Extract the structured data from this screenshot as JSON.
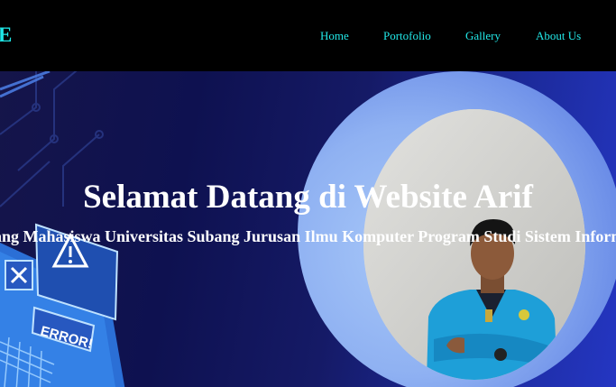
{
  "brand": {
    "logo_text": "E"
  },
  "nav": {
    "items": [
      {
        "label": "Home"
      },
      {
        "label": "Portofolio"
      },
      {
        "label": "Gallery"
      },
      {
        "label": "About Us"
      }
    ]
  },
  "hero": {
    "headline": "Selamat Datang di Website Arif",
    "subline": "Seorang Mahasiswa Universitas Subang Jurusan Ilmu Komputer Program Studi Sistem Informasi",
    "illustration": {
      "label": "ERROR!"
    }
  },
  "colors": {
    "nav_background": "#000000",
    "nav_link": "#22e8e8",
    "hero_gradient_start": "#15154a",
    "hero_gradient_end": "#2436c2",
    "ring": "#8fb1f2",
    "jacket": "#1e9fd8"
  }
}
